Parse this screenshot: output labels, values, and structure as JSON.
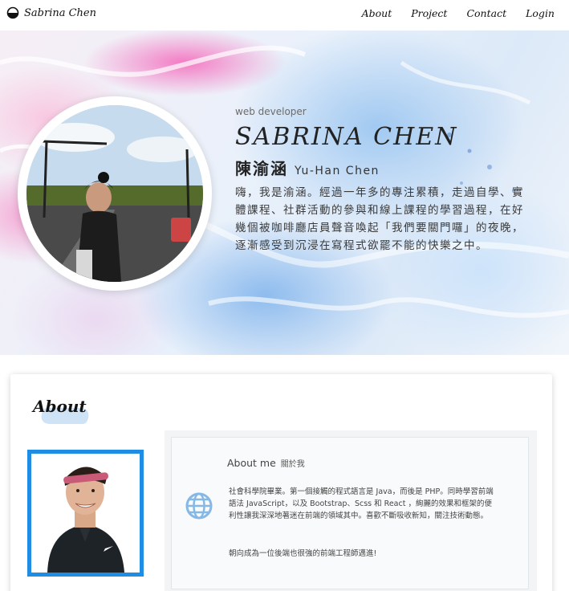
{
  "navbar": {
    "brand": "Sabrina Chen",
    "brand_icon": "half-circle-logo-icon",
    "links": [
      "About",
      "Project",
      "Contact",
      "Login"
    ]
  },
  "hero": {
    "role": "web developer",
    "name": "SABRINA CHEN",
    "chinese_name": "陳渝涵",
    "english_name": "Yu-Han Chen",
    "bio": "嗨，我是渝涵。經過一年多的專注累積，走過自學、實體課程、社群活動的參與和線上課程的學習過程，在好幾個被咖啡廳店員聲音喚起「我們要關門囉」的夜晚，逐漸感受到沉浸在寫程式欲罷不能的快樂之中。"
  },
  "about": {
    "heading": "About",
    "panel_title": "About me",
    "panel_title_zh": "關於我",
    "panel_icon": "globe-icon",
    "body": "社會科學院畢業。第一個接觸的程式語言是 Java，而後是 PHP。同時學習前端語法 JavaScript，以及 Bootstrap、Scss 和 React ，絢麗的效果和框架的便利性讓我深深地著迷在前端的領域其中。喜歡不斷吸收新知，關注技術動態。",
    "goal": "朝向成為一位後端也很強的前端工程師邁進!"
  },
  "colors": {
    "accent_blue": "#1f8de4",
    "brush_blue": "#cfe3f6",
    "hero_pink": "#f46ebe",
    "hero_blue": "#96c3f0"
  }
}
